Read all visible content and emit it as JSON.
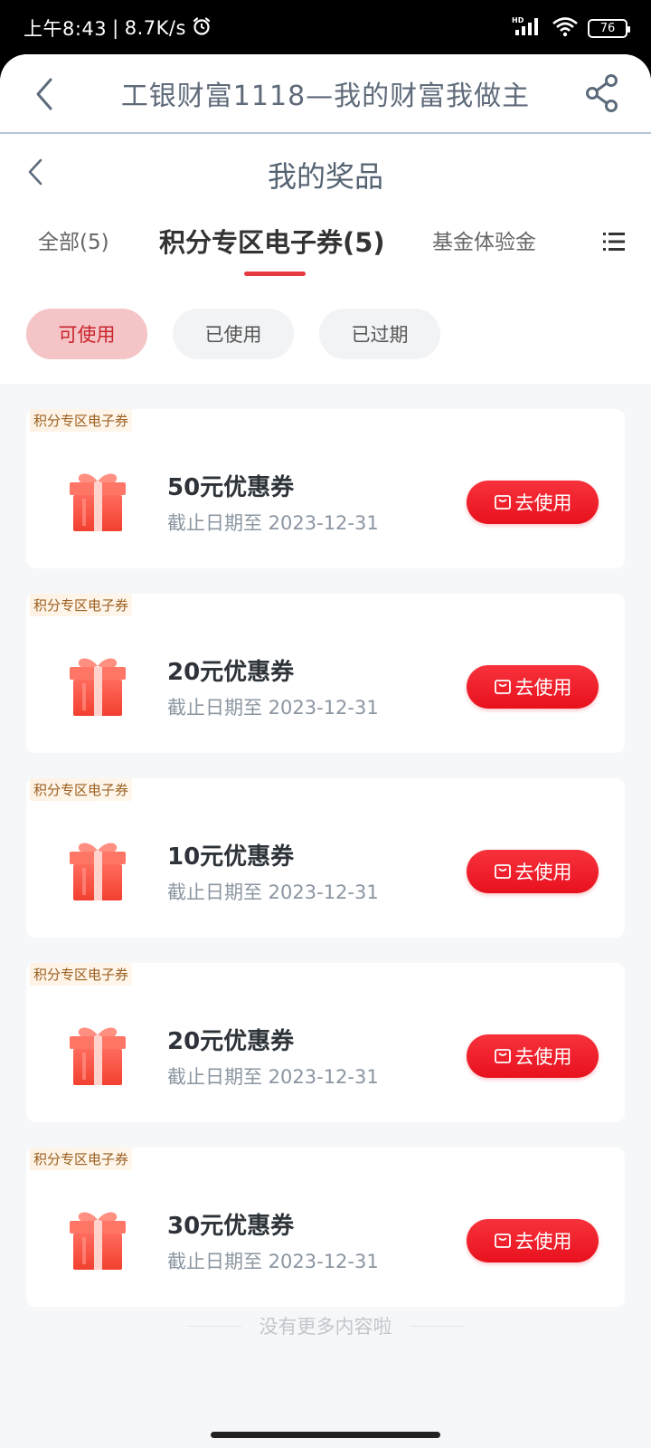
{
  "status": {
    "time": "上午8:43",
    "separator": "|",
    "speed": "8.7K/s",
    "battery": "76",
    "icons": [
      "alarm-icon",
      "hd-signal-icon",
      "wifi-icon",
      "battery-icon"
    ]
  },
  "header": {
    "title": "工银财富1118—我的财富我做主"
  },
  "page": {
    "title": "我的奖品"
  },
  "tabs": [
    {
      "label": "全部(5)"
    },
    {
      "label": "积分专区电子券(5)"
    },
    {
      "label": "基金体验金"
    }
  ],
  "filters": [
    {
      "label": "可使用"
    },
    {
      "label": "已使用"
    },
    {
      "label": "已过期"
    }
  ],
  "coupons": [
    {
      "tag": "积分专区电子券",
      "title": "50元优惠券",
      "date": "截止日期至 2023-12-31",
      "button": "去使用"
    },
    {
      "tag": "积分专区电子券",
      "title": "20元优惠券",
      "date": "截止日期至 2023-12-31",
      "button": "去使用"
    },
    {
      "tag": "积分专区电子券",
      "title": "10元优惠券",
      "date": "截止日期至 2023-12-31",
      "button": "去使用"
    },
    {
      "tag": "积分专区电子券",
      "title": "20元优惠券",
      "date": "截止日期至 2023-12-31",
      "button": "去使用"
    },
    {
      "tag": "积分专区电子券",
      "title": "30元优惠券",
      "date": "截止日期至 2023-12-31",
      "button": "去使用"
    }
  ],
  "footer": {
    "note": "没有更多内容啦"
  },
  "colors": {
    "accent": "#e53a41",
    "button": "#f0202c",
    "active_chip_bg": "#f4c4c6"
  }
}
